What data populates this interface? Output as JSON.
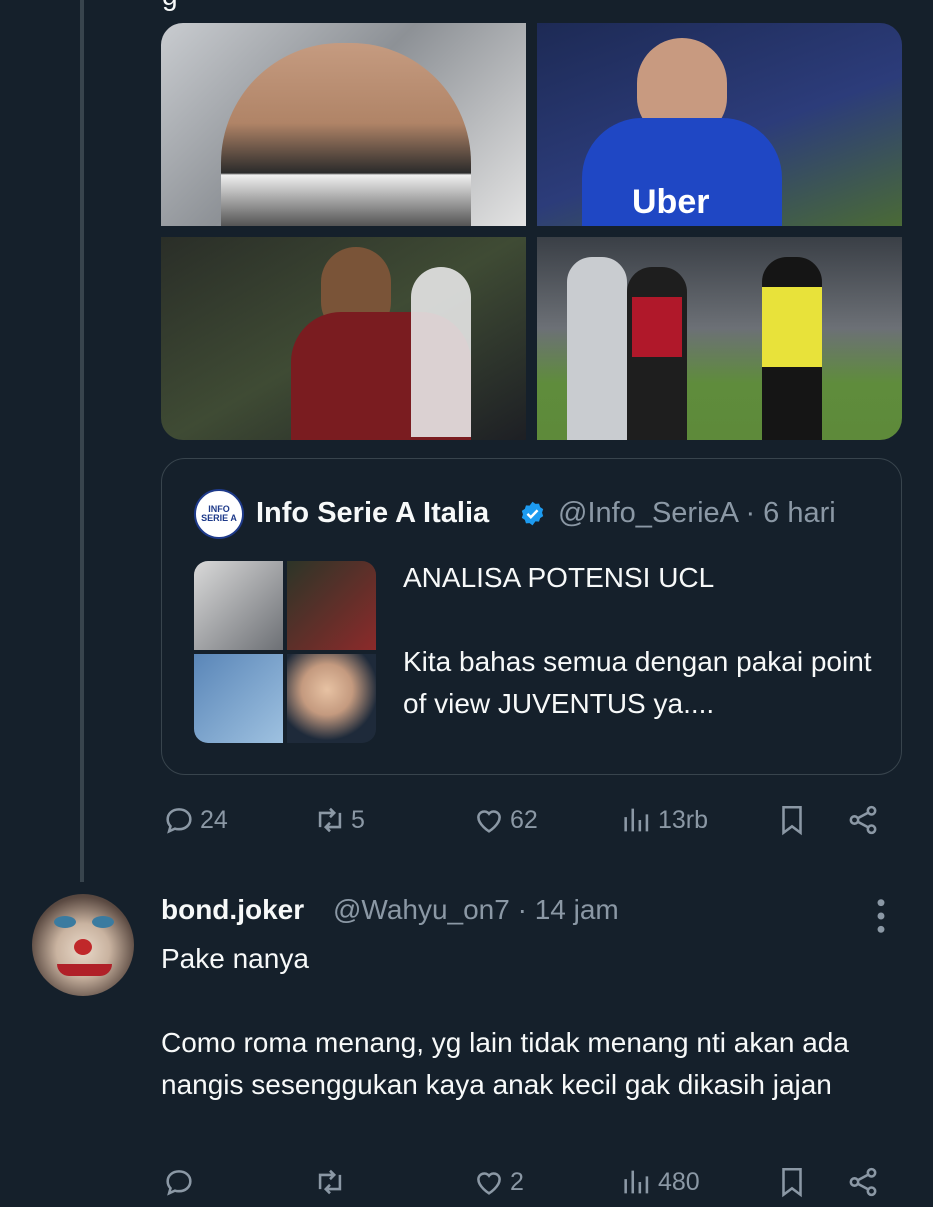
{
  "top_cutoff_text": "g",
  "post": {
    "media": [
      {
        "label": "photo-1"
      },
      {
        "label": "photo-2",
        "shirt_text": "Uber"
      },
      {
        "label": "photo-3"
      },
      {
        "label": "photo-4"
      }
    ],
    "quote": {
      "avatar_text": "INFO SERIE A",
      "name": "Info Serie A Italia",
      "handle_time": "@Info_SerieA · 6 hari",
      "text": "ANALISA POTENSI UCL\n\nKita bahas semua dengan pakai point of view JUVENTUS ya...."
    },
    "actions": {
      "replies": "24",
      "reposts": "5",
      "likes": "62",
      "views": "13rb"
    }
  },
  "reply": {
    "name": "bond.joker",
    "handle_time": "@Wahyu_on7 · 14 jam",
    "text": "Pake nanya\n\nComo roma menang, yg lain tidak menang nti akan ada nangis sesenggukan kaya anak kecil gak dikasih jajan",
    "actions": {
      "replies": "",
      "reposts": "",
      "likes": "2",
      "views": "480"
    }
  },
  "colors": {
    "background": "#15202b",
    "text": "#f7f9f9",
    "muted": "#8b98a5",
    "border": "#38444d",
    "verified": "#1d9bf0"
  }
}
